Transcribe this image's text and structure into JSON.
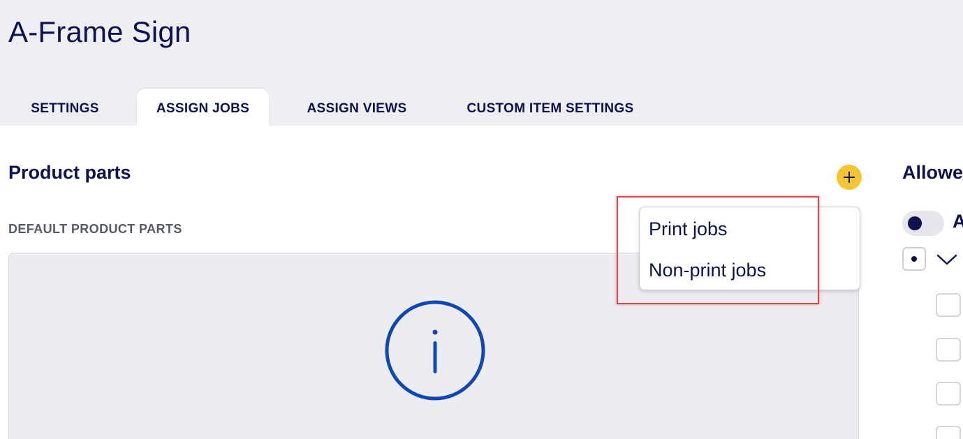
{
  "page": {
    "title": "A-Frame Sign"
  },
  "tabs": [
    {
      "label": "SETTINGS",
      "active": false
    },
    {
      "label": "ASSIGN JOBS",
      "active": true
    },
    {
      "label": "ASSIGN VIEWS",
      "active": false
    },
    {
      "label": "CUSTOM ITEM SETTINGS",
      "active": false
    }
  ],
  "product_parts": {
    "title": "Product parts",
    "add_icon": "plus-icon",
    "subheading": "DEFAULT PRODUCT PARTS",
    "info_icon": "info-icon"
  },
  "add_menu": {
    "items": [
      {
        "label": "Print jobs"
      },
      {
        "label": "Non-print jobs"
      }
    ]
  },
  "allowed": {
    "title": "Allowe",
    "toggle_label": "A",
    "chevron_icon": "chevron-down-icon"
  },
  "colors": {
    "accent": "#f5c432",
    "primary_text": "#0c1150",
    "info_blue": "#0d47b8",
    "highlight": "#e0474a",
    "header_bg": "#eeeef3"
  }
}
